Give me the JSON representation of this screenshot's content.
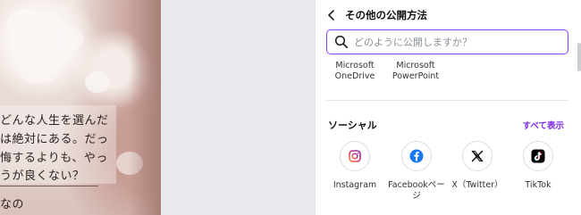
{
  "canvas": {
    "lines": [
      "どんな人生を選んだ",
      "は絶対にある。だっ",
      "悔するよりも、やっ",
      "うが良くない？",
      "なの"
    ]
  },
  "panel": {
    "title": "その他の公開方法",
    "search_placeholder": "どのように公開しますか？",
    "apps": [
      {
        "label": "Microsoft\nOneDrive"
      },
      {
        "label": "Microsoft\nPowerPoint"
      }
    ],
    "social": {
      "title": "ソーシャル",
      "see_all": "すべて表示",
      "items": [
        {
          "label": "Instagram",
          "icon": "instagram-icon"
        },
        {
          "label": "Facebookページ",
          "icon": "facebook-icon"
        },
        {
          "label": "X（Twitter）",
          "icon": "x-twitter-icon"
        },
        {
          "label": "TikTok",
          "icon": "tiktok-icon"
        }
      ]
    }
  },
  "colors": {
    "accent": "#8b3dff",
    "link": "#7d2ae8",
    "facebook": "#1877f2",
    "instagram": "#e1306c",
    "tiktok_bg": "#000000"
  }
}
